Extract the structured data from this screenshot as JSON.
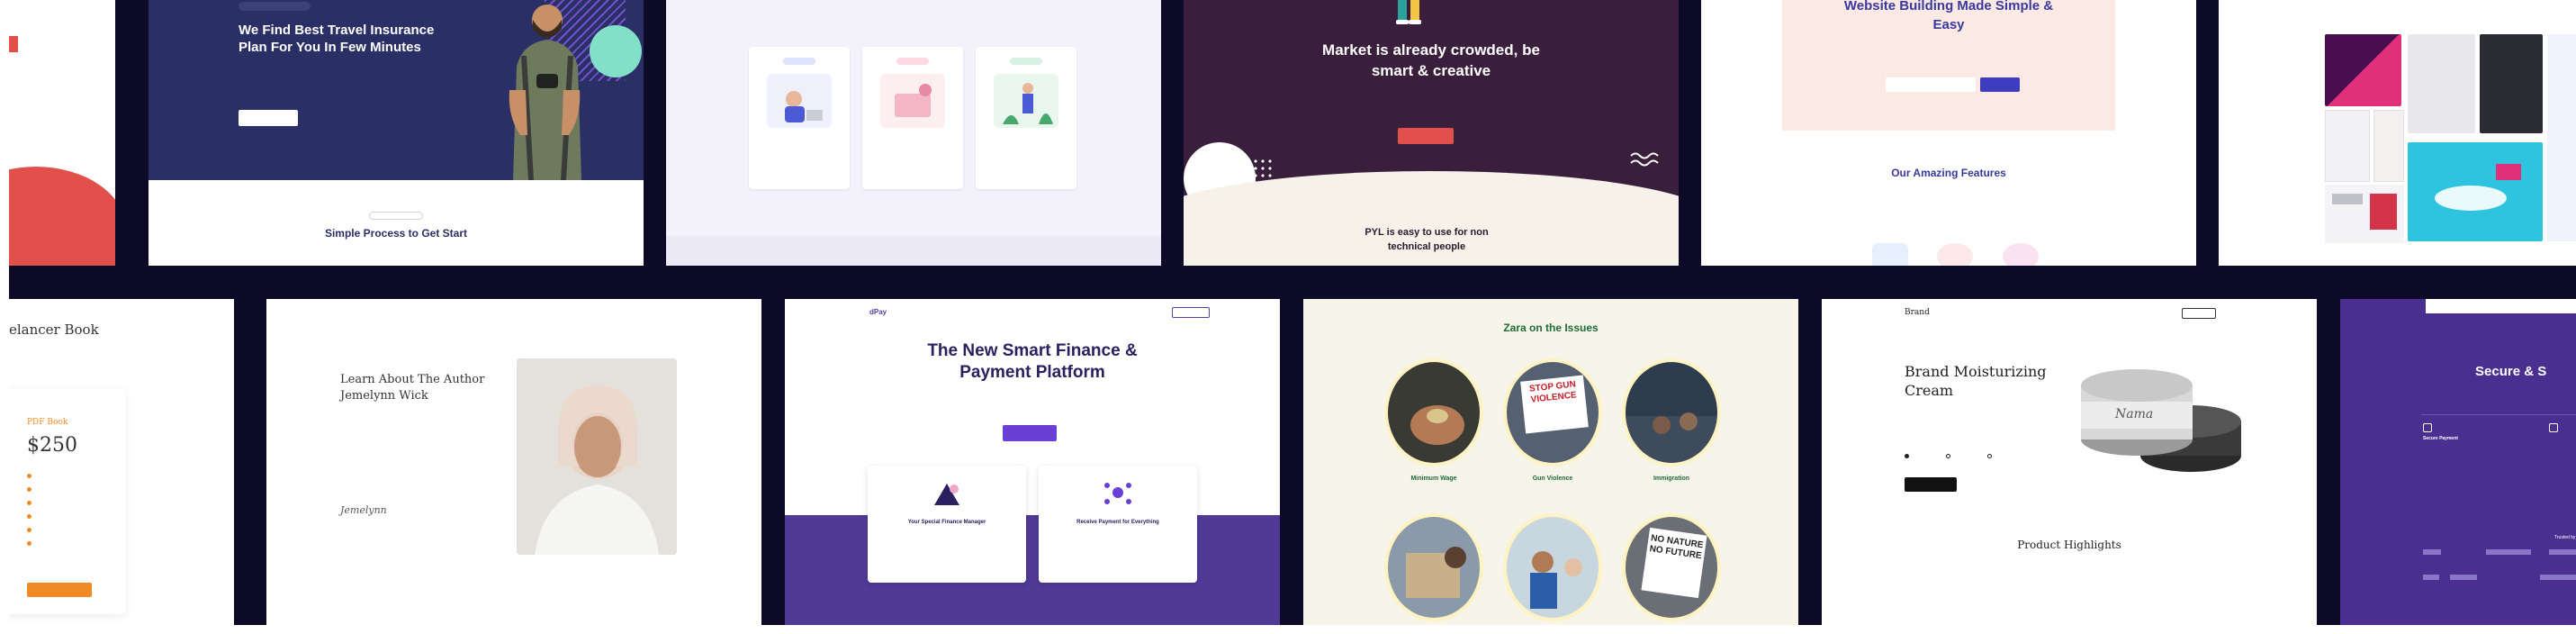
{
  "tile1": {
    "badge": "",
    "heading": "We Find Best Travel Insurance Plan For You In Few Minutes",
    "body": "",
    "cta": "",
    "note": "",
    "section_kicker": "",
    "section_title": "Simple Process to Get Start"
  },
  "tile2": {
    "intro": "",
    "steps": [
      {
        "tag": "",
        "title": ""
      },
      {
        "tag": "",
        "title": ""
      },
      {
        "tag": "",
        "title": ""
      }
    ],
    "footer": ""
  },
  "tile3": {
    "heading": "Market is already crowded, be smart & creative",
    "body": "",
    "cta": "",
    "subheading": "PYL is easy to use for non technical people"
  },
  "tile4": {
    "heading": "Website Building Made Simple & Easy",
    "body": "",
    "email_placeholder": "",
    "submit": "",
    "features_title": "Our Amazing Features"
  },
  "tile5": {
    "caption": ""
  },
  "tile6": {
    "title": "elancer Book",
    "subtitle": "",
    "label": "PDF Book",
    "price": "$250",
    "bullets": [
      "",
      "",
      "",
      "",
      "",
      ""
    ],
    "cta": ""
  },
  "tile7": {
    "heading": "Learn About The Author",
    "author": "Jemelynn Wick",
    "para1": "",
    "para2": "",
    "signature": "Jemelynn"
  },
  "tile8": {
    "logo": "dPay",
    "nav": [
      "",
      "",
      "",
      ""
    ],
    "nav_cta": "",
    "heading": "The New Smart Finance & Payment Platform",
    "body": "",
    "cta": "",
    "cards": [
      {
        "title": "Your Special Finance Manager",
        "link": ""
      },
      {
        "title": "Receive Payment for Everything",
        "link": ""
      }
    ]
  },
  "tile9": {
    "heading": "Zara on the Issues",
    "issues": [
      {
        "label": "Minimum Wage"
      },
      {
        "label": "Gun Violence",
        "sign": "STOP GUN VIOLENCE"
      },
      {
        "label": "Immigration"
      },
      {
        "label": ""
      },
      {
        "label": ""
      },
      {
        "label": "",
        "sign": "NO NATURE NO FUTURE"
      }
    ]
  },
  "tile10": {
    "logo": "Brand",
    "nav": [
      "",
      "",
      "",
      ""
    ],
    "nav_cta": "",
    "heading": "Brand Moisturizing Cream",
    "body": "",
    "options_label": "",
    "options": [
      "",
      "",
      ""
    ],
    "cta": "",
    "jar_label": "Nama",
    "section_title": "Product Highlights",
    "section_body": ""
  },
  "tile11": {
    "heading": "Secure & S",
    "body": "",
    "features": [
      {
        "title": "Secure Payment"
      },
      {
        "title": ""
      }
    ],
    "partners_title": "Trusted by"
  },
  "colors": {
    "wall": "#0c0a26",
    "navy": "#2a2f66",
    "navy_deep": "#1f2355",
    "maroon": "#3a1f3d",
    "cream": "#f6f2ea",
    "purple": "#5b3ea4",
    "purple_deep": "#4a2f90",
    "coral": "#e2504b",
    "orange": "#f08a24",
    "green": "#1f6b3a",
    "peach": "#fbe9e4",
    "lavender": "#f3f2fb"
  }
}
